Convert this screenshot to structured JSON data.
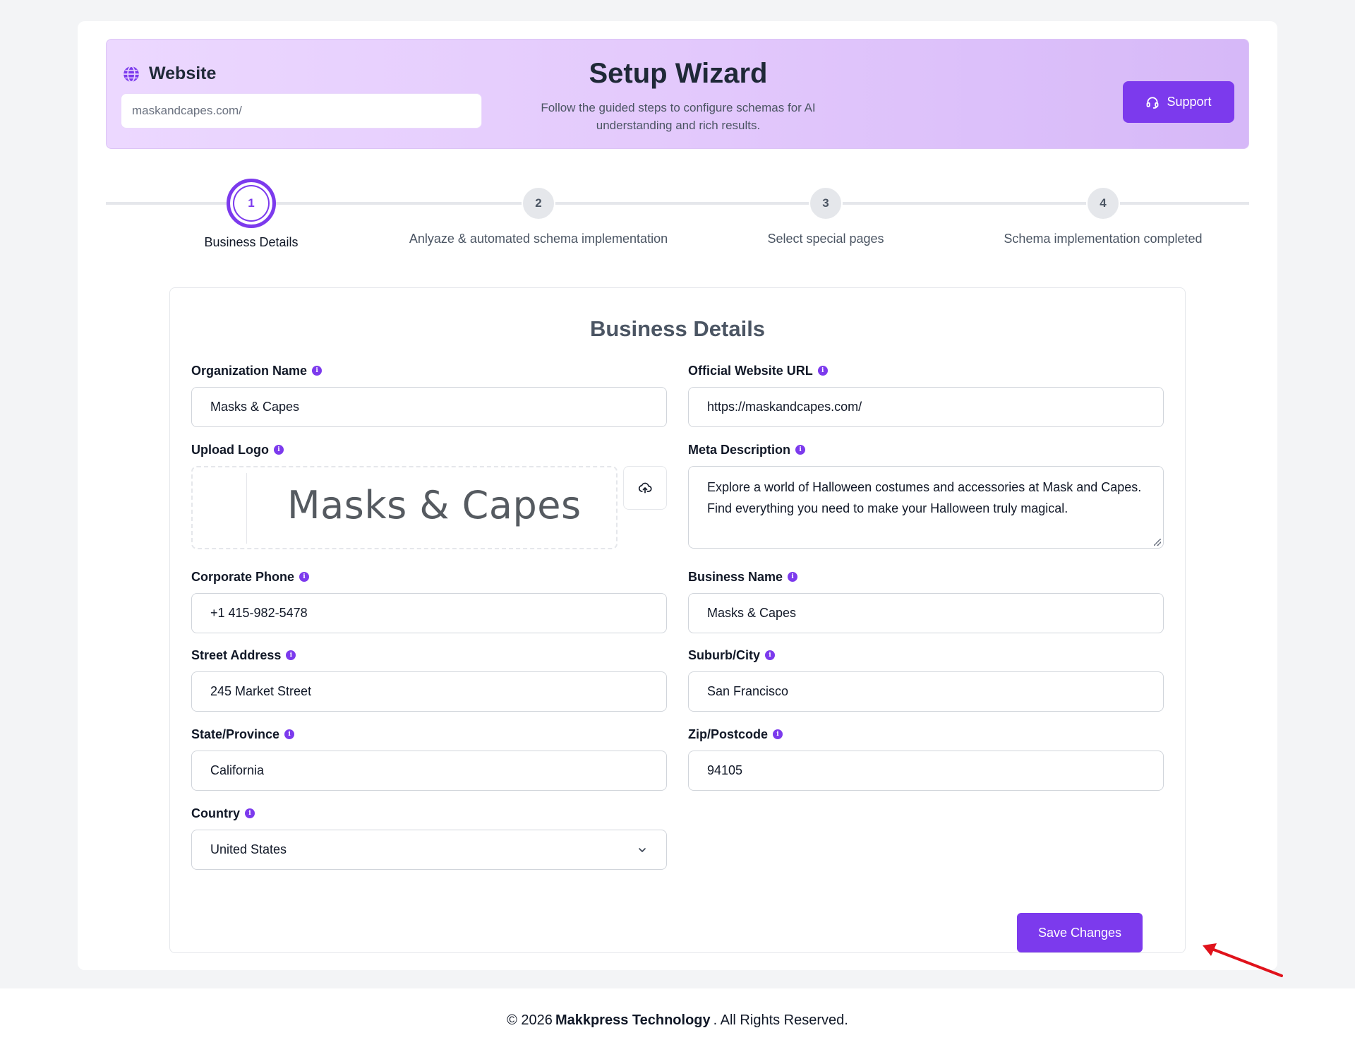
{
  "header": {
    "site_label": "Website",
    "site_value": "maskandcapes.com/",
    "title": "Setup Wizard",
    "subtitle": "Follow the guided steps to configure schemas for AI understanding and rich results.",
    "support_label": "Support"
  },
  "steps": [
    {
      "number": "1",
      "label": "Business Details",
      "active": true
    },
    {
      "number": "2",
      "label": "Anlyaze & automated schema implementation",
      "active": false
    },
    {
      "number": "3",
      "label": "Select special pages",
      "active": false
    },
    {
      "number": "4",
      "label": "Schema implementation completed",
      "active": false
    }
  ],
  "form": {
    "title": "Business Details",
    "organization_name": {
      "label": "Organization Name",
      "value": "Masks & Capes"
    },
    "website_url": {
      "label": "Official Website URL",
      "value": "https://maskandcapes.com/"
    },
    "upload_logo": {
      "label": "Upload Logo",
      "logo_text": "Masks & Capes"
    },
    "meta_description": {
      "label": "Meta Description",
      "value": "Explore a world of Halloween costumes and accessories at Mask and Capes. Find everything you need to make your Halloween truly magical."
    },
    "corporate_phone": {
      "label": "Corporate Phone",
      "value": "+1 415-982-5478"
    },
    "business_name": {
      "label": "Business Name",
      "value": "Masks & Capes"
    },
    "street_address": {
      "label": "Street Address",
      "value": "245 Market Street"
    },
    "city": {
      "label": "Suburb/City",
      "value": "San Francisco"
    },
    "state": {
      "label": "State/Province",
      "value": "California"
    },
    "zip": {
      "label": "Zip/Postcode",
      "value": "94105"
    },
    "country": {
      "label": "Country",
      "value": "United States"
    },
    "save_label": "Save Changes"
  },
  "footer": {
    "prefix": "© 2026",
    "company": "Makkpress Technology",
    "suffix": ". All Rights Reserved."
  },
  "colors": {
    "accent": "#7c3aed",
    "annotation_arrow": "#e0121b"
  }
}
